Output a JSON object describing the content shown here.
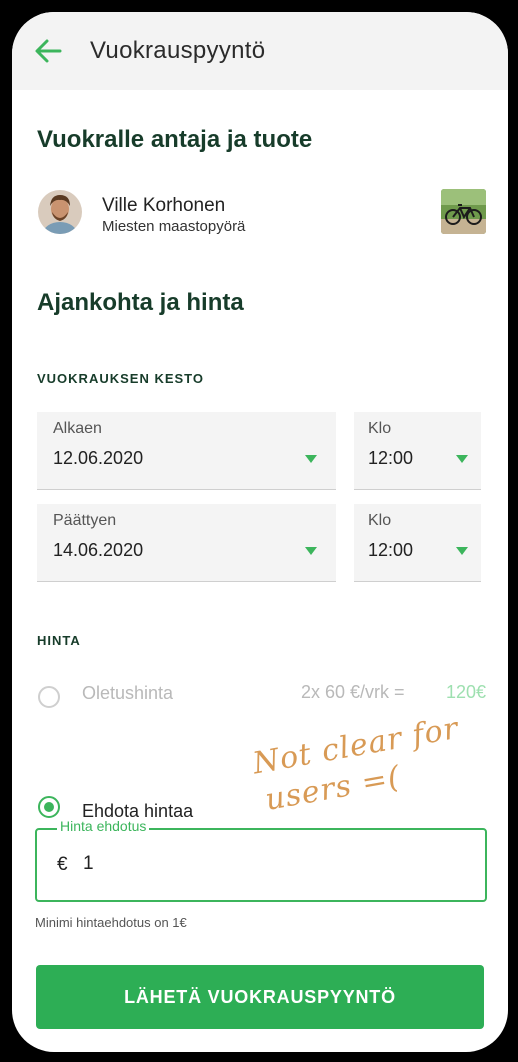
{
  "appbar": {
    "title": "Vuokrauspyyntö",
    "back_icon": "arrow-left-icon"
  },
  "owner_section": {
    "title": "Vuokralle antaja ja tuote",
    "owner_name": "Ville Korhonen",
    "product_name": "Miesten maastopyörä"
  },
  "time_price_section": {
    "title": "Ajankohta ja hinta"
  },
  "duration": {
    "heading": "VUOKRAUKSEN KESTO",
    "start_date": {
      "label": "Alkaen",
      "value": "12.06.2020"
    },
    "start_time": {
      "label": "Klo",
      "value": "12:00"
    },
    "end_date": {
      "label": "Päättyen",
      "value": "14.06.2020"
    },
    "end_time": {
      "label": "Klo",
      "value": "12:00"
    }
  },
  "price": {
    "heading": "HINTA",
    "default_option": {
      "label": "Oletushinta",
      "calc": "2x 60 €/vrk =",
      "total": "120€",
      "selected": false
    },
    "suggest_option": {
      "label": "Ehdota hintaa",
      "selected": true
    },
    "suggestion_field": {
      "label": "Hinta ehdotus",
      "currency": "€",
      "value": "1"
    },
    "helper": "Minimi hintaehdotus on 1€"
  },
  "annotation": {
    "line1": "Not clear for",
    "line2": "users =("
  },
  "submit_label": "LÄHETÄ VUOKRAUSPYYNTÖ",
  "colors": {
    "accent": "#3cb55c",
    "heading": "#173c2a",
    "button": "#2dae55",
    "annotation": "#d89a55"
  }
}
